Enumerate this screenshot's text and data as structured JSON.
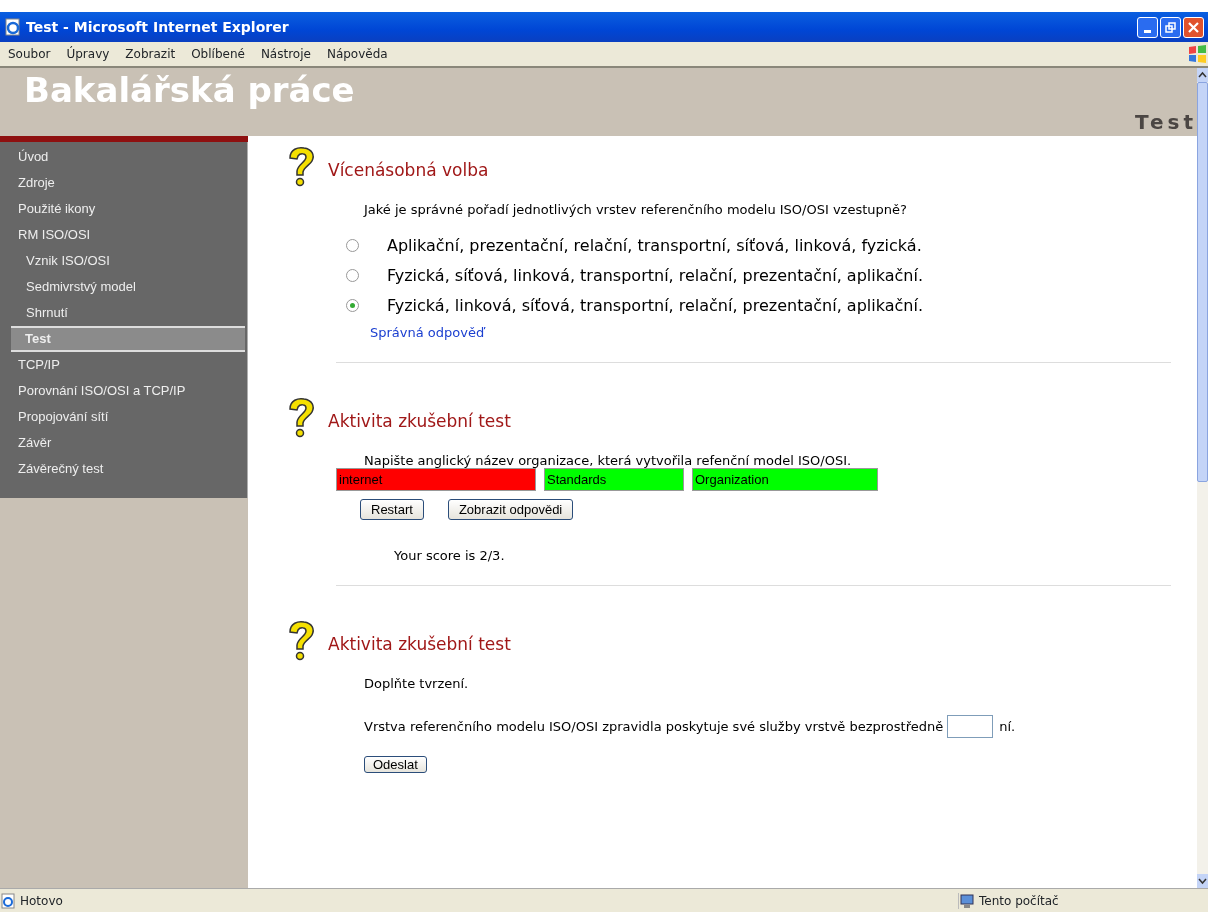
{
  "window": {
    "title": "Test - Microsoft Internet Explorer"
  },
  "menu": [
    "Soubor",
    "Úpravy",
    "Zobrazit",
    "Oblíbené",
    "Nástroje",
    "Nápověda"
  ],
  "header": {
    "title": "Bakalářská práce",
    "page_title": "Test"
  },
  "sidebar": {
    "items": [
      {
        "label": "Úvod",
        "selected": false
      },
      {
        "label": "Zdroje",
        "selected": false
      },
      {
        "label": "Použité ikony",
        "selected": false
      },
      {
        "label": "RM ISO/OSI",
        "selected": false,
        "children": [
          {
            "label": "Vznik ISO/OSI",
            "selected": false
          },
          {
            "label": "Sedmivrstvý model",
            "selected": false
          },
          {
            "label": "Shrnutí",
            "selected": false
          },
          {
            "label": "Test",
            "selected": true
          }
        ]
      },
      {
        "label": "TCP/IP",
        "selected": false
      },
      {
        "label": "Porovnání ISO/OSI a TCP/IP",
        "selected": false
      },
      {
        "label": "Propojování sítí",
        "selected": false
      },
      {
        "label": "Závěr",
        "selected": false
      },
      {
        "label": "Závěrečný test",
        "selected": false
      }
    ]
  },
  "activities": [
    {
      "kind": "choice",
      "title": "Vícenásobná volba",
      "question": "Jaké je správné pořadí jednotlivých vrstev referenčního modelu ISO/OSI vzestupně?",
      "options": [
        {
          "label": "Aplikační, prezentační, relační, transportní, síťová, linková, fyzická.",
          "selected": false
        },
        {
          "label": "Fyzická, síťová, linková, transportní, relační, prezentační, aplikační.",
          "selected": false
        },
        {
          "label": "Fyzická, linková, síťová, transportní, relační, prezentační, aplikační.",
          "selected": true
        }
      ],
      "feedback": "Správná odpověď"
    },
    {
      "kind": "cloze",
      "title": "Aktivita zkušební test",
      "question": "Napište anglický název organizace, která vytvořila refenční model ISO/OSI.",
      "fields": [
        {
          "value": "internet",
          "correct": false
        },
        {
          "value": "Standards",
          "correct": true
        },
        {
          "value": "Organization",
          "correct": true
        }
      ],
      "buttons": [
        "Restart",
        "Zobrazit odpovědi"
      ],
      "score": "Your score is 2/3."
    },
    {
      "kind": "fill",
      "title": "Aktivita zkušební test",
      "question": "Doplňte tvrzení.",
      "sentence_before": "Vrstva referenčního modelu ISO/OSI zpravidla poskytuje své služby vrstvě bezprostředně",
      "sentence_after": "ní.",
      "button": "Odeslat"
    }
  ],
  "status_bar": {
    "text": "Hotovo",
    "zone": "Tento počítač"
  }
}
